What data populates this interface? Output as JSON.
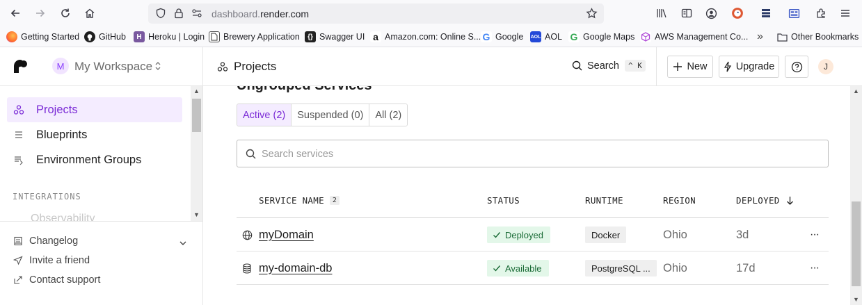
{
  "browser": {
    "url_prefix": "dashboard.",
    "url_domain": "render.com",
    "bookmarks": [
      {
        "label": "Getting Started",
        "icon": "firefox-icon"
      },
      {
        "label": "GitHub",
        "icon": "github-icon"
      },
      {
        "label": "Heroku | Login",
        "icon": "heroku-icon"
      },
      {
        "label": "Brewery Application",
        "icon": "page-icon"
      },
      {
        "label": "Swagger UI",
        "icon": "swagger-icon"
      },
      {
        "label": "Amazon.com: Online S...",
        "icon": "amazon-icon"
      },
      {
        "label": "Google",
        "icon": "google-icon"
      },
      {
        "label": "AOL",
        "icon": "aol-icon"
      },
      {
        "label": "Google Maps",
        "icon": "google-icon"
      },
      {
        "label": "AWS Management Co...",
        "icon": "aws-icon"
      }
    ],
    "other_bookmarks": "Other Bookmarks",
    "overflow": "»"
  },
  "workspace": {
    "avatar_initial": "M",
    "name": "My Workspace"
  },
  "sidebar": {
    "items": [
      {
        "label": "Projects",
        "icon": "projects-icon",
        "active": true
      },
      {
        "label": "Blueprints",
        "icon": "blueprints-icon",
        "active": false
      },
      {
        "label": "Environment Groups",
        "icon": "env-groups-icon",
        "active": false
      }
    ],
    "section_label": "INTEGRATIONS",
    "faded_item": "Observability",
    "footer": [
      {
        "label": "Changelog",
        "icon": "changelog-icon"
      },
      {
        "label": "Invite a friend",
        "icon": "send-icon"
      },
      {
        "label": "Contact support",
        "icon": "external-link-icon"
      }
    ]
  },
  "topbar": {
    "title": "Projects",
    "search_label": "Search",
    "search_shortcut": "^ K",
    "new_label": "New",
    "upgrade_label": "Upgrade",
    "user_initial": "J"
  },
  "main": {
    "section_title": "Ungrouped Services",
    "tabs": [
      {
        "label": "Active (2)",
        "active": true
      },
      {
        "label": "Suspended (0)",
        "active": false
      },
      {
        "label": "All (2)",
        "active": false
      }
    ],
    "search_placeholder": "Search services",
    "columns": {
      "service_name": "SERVICE NAME",
      "service_count": "2",
      "status": "STATUS",
      "runtime": "RUNTIME",
      "region": "REGION",
      "deployed": "DEPLOYED"
    },
    "rows": [
      {
        "icon": "globe-icon",
        "name": "myDomain",
        "status": "Deployed",
        "runtime": "Docker",
        "region": "Ohio",
        "deployed": "3d",
        "more": "···"
      },
      {
        "icon": "database-icon",
        "name": "my-domain-db",
        "status": "Available",
        "runtime": "PostgreSQL ...",
        "region": "Ohio",
        "deployed": "17d",
        "more": "···"
      }
    ]
  },
  "colors": {
    "accent": "#7a2ad6",
    "accent_bg": "#f4ecff",
    "status_green_bg": "#e3f7e9",
    "status_green_text": "#1a6b36"
  }
}
